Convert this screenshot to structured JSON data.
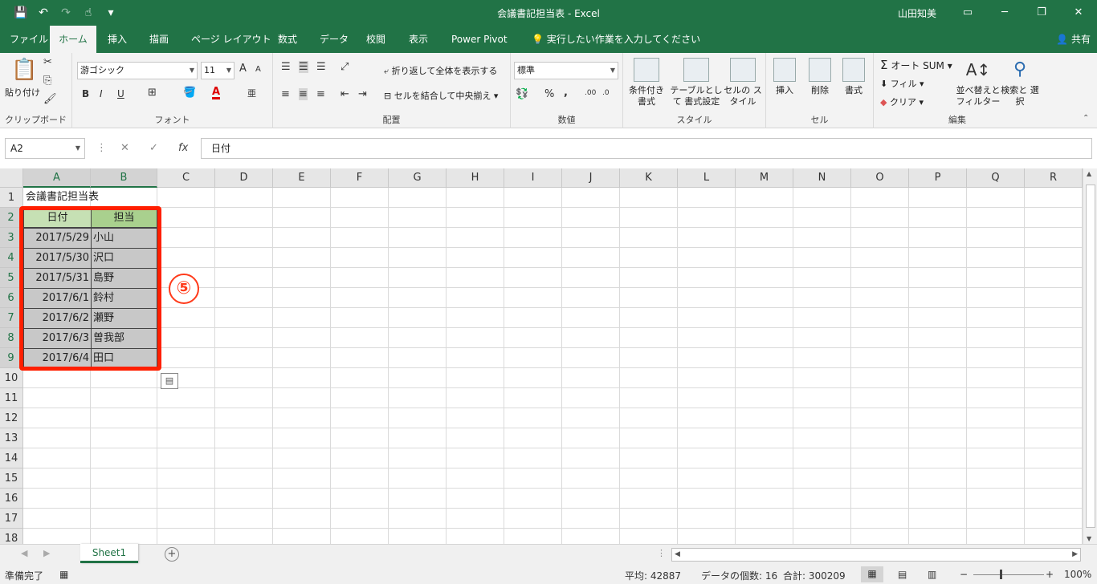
{
  "window": {
    "title": "会議書記担当表 - Excel",
    "user": "山田知美",
    "qat": [
      "save-icon",
      "undo-icon",
      "redo-icon",
      "touch-mode-icon",
      "customize-icon"
    ],
    "share": "共有"
  },
  "tabs": [
    "ファイル",
    "ホーム",
    "挿入",
    "描画",
    "ページ レイアウト",
    "数式",
    "データ",
    "校閲",
    "表示",
    "Power Pivot"
  ],
  "tell_me": "実行したい作業を入力してください",
  "ribbon": {
    "clipboard": {
      "label": "クリップボード",
      "paste": "貼り付け"
    },
    "font": {
      "label": "フォント",
      "name": "游ゴシック",
      "size": "11",
      "bold": "B",
      "italic": "I",
      "underline": "U",
      "grow": "A",
      "shrink": "A",
      "color_a": "A"
    },
    "alignment": {
      "label": "配置",
      "wrap": "折り返して全体を表示する",
      "merge": "セルを結合して中央揃え"
    },
    "number": {
      "label": "数値",
      "format": "標準",
      "percent": "%",
      "comma": ","
    },
    "styles": {
      "label": "スタイル",
      "conditional": "条件付き 書式",
      "table": "テーブルとして 書式設定",
      "cell": "セルの スタイル"
    },
    "cells": {
      "label": "セル",
      "insert": "挿入",
      "delete": "削除",
      "format": "書式"
    },
    "editing": {
      "label": "編集",
      "autosum": "オート SUM",
      "fill": "フィル",
      "clear": "クリア",
      "sort": "並べ替えと フィルター",
      "find": "検索と 選択"
    }
  },
  "formula_bar": {
    "name_box": "A2",
    "cancel": "✕",
    "enter": "✓",
    "fx": "fx",
    "content": "日付"
  },
  "columns": [
    "A",
    "B",
    "C",
    "D",
    "E",
    "F",
    "G",
    "H",
    "I",
    "J",
    "K",
    "L",
    "M",
    "N",
    "O",
    "P",
    "Q",
    "R"
  ],
  "rows": [
    "1",
    "2",
    "3",
    "4",
    "5",
    "6",
    "7",
    "8",
    "9",
    "10",
    "11",
    "12",
    "13",
    "14",
    "15",
    "16",
    "17",
    "18"
  ],
  "sheet": {
    "title": "会議書記担当表",
    "header": [
      "日付",
      "担当"
    ],
    "data": [
      [
        "2017/5/29",
        "小山"
      ],
      [
        "2017/5/30",
        "沢口"
      ],
      [
        "2017/5/31",
        "島野"
      ],
      [
        "2017/6/1",
        "鈴村"
      ],
      [
        "2017/6/2",
        "瀬野"
      ],
      [
        "2017/6/3",
        "曽我部"
      ],
      [
        "2017/6/4",
        "田口"
      ]
    ]
  },
  "annotation": "⑤",
  "sheet_tabs": [
    "Sheet1"
  ],
  "status": {
    "ready": "準備完了",
    "average": "平均: 42887",
    "count": "データの個数: 16",
    "sum": "合計: 300209",
    "zoom": "100%"
  },
  "colors": {
    "brand": "#217346",
    "header_fill": "#a9d08e",
    "data_fill": "#c8c8c8",
    "highlight": "#ff1f00"
  }
}
